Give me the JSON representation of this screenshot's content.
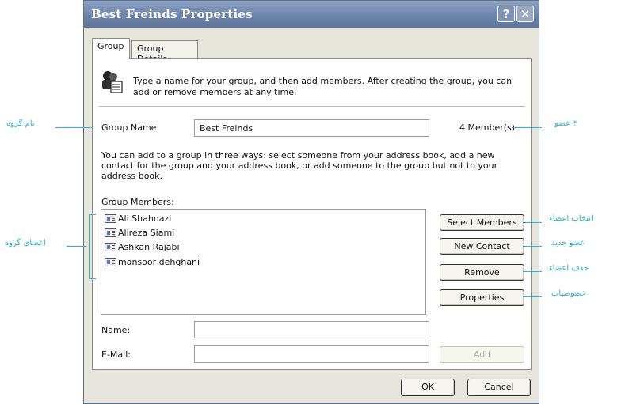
{
  "window": {
    "title": "Best Freinds Properties",
    "help_glyph": "?",
    "close_glyph": "✕"
  },
  "tabs": [
    {
      "label": "Group",
      "active": true
    },
    {
      "label": "Group Details",
      "active": false
    }
  ],
  "intro": {
    "text": "Type a name for your group, and then add members. After creating the group, you can add or remove members at any time."
  },
  "group_name": {
    "label": "Group Name:",
    "value": "Best Freinds",
    "member_count": "4 Member(s)"
  },
  "help_text": "You can add to a group in three ways: select someone from your address book, add a new contact for the group and your address book, or add someone to the group but not to your address book.",
  "members": {
    "label": "Group Members:",
    "items": [
      "Ali Shahnazi",
      "Alireza Siami",
      "Ashkan Rajabi",
      "mansoor dehghani"
    ]
  },
  "buttons": {
    "select_members": "Select Members",
    "new_contact": "New Contact",
    "remove": "Remove",
    "properties": "Properties",
    "add": "Add",
    "ok": "OK",
    "cancel": "Cancel"
  },
  "fields": {
    "name_label": "Name:",
    "name_value": "",
    "email_label": "E-Mail:",
    "email_value": ""
  },
  "annotations": {
    "group_name": "نام گروه",
    "group_members": "اعضای گروه",
    "member_count": "۴ عضو",
    "select_members": "انتخاب اعضاء",
    "new_contact": "عضو جدید",
    "remove": "حذف اعضاء",
    "properties": "خصوصیات"
  },
  "colors": {
    "annotation": "#2ab3e0",
    "titlebar": "#6d84aa"
  }
}
